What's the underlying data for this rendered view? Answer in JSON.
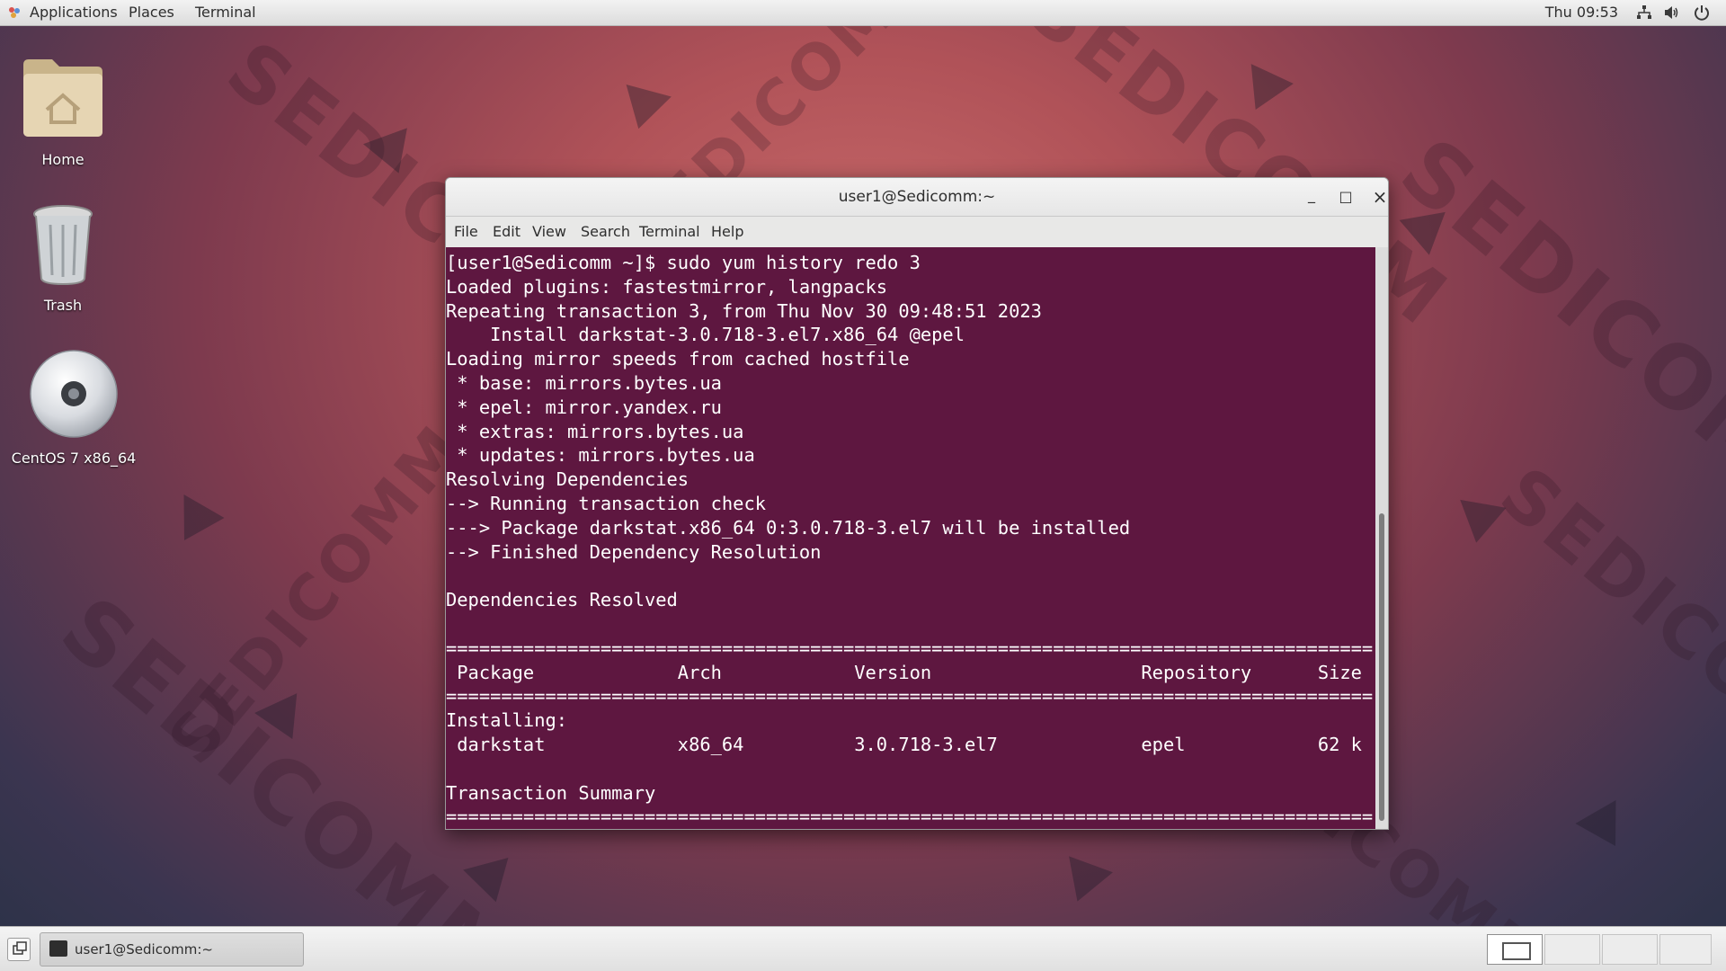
{
  "top_panel": {
    "menus": [
      "Applications",
      "Places",
      "Terminal"
    ],
    "clock": "Thu 09:53",
    "tray_icons": [
      "network-icon",
      "volume-icon",
      "power-icon"
    ]
  },
  "desktop": {
    "icons": [
      {
        "label": "Home",
        "icon": "home-folder-icon"
      },
      {
        "label": "Trash",
        "icon": "trash-icon"
      },
      {
        "label": "CentOS 7 x86_64",
        "icon": "disc-icon"
      }
    ],
    "wallpaper_text": "SEDICOMM",
    "colors": {
      "wallpaper_center": "#c86a6a",
      "wallpaper_edge": "#2a3247"
    }
  },
  "terminal_window": {
    "title": "user1@Sedicomm:~",
    "controls": {
      "minimize": "_",
      "maximize": "□",
      "close": "×"
    },
    "menu": [
      "File",
      "Edit",
      "View",
      "Search",
      "Terminal",
      "Help"
    ],
    "background_color": "#5e1740",
    "text_color": "#ffffff",
    "lines": [
      "[user1@Sedicomm ~]$ sudo yum history redo 3",
      "Loaded plugins: fastestmirror, langpacks",
      "Repeating transaction 3, from Thu Nov 30 09:48:51 2023",
      "    Install darkstat-3.0.718-3.el7.x86_64 @epel",
      "Loading mirror speeds from cached hostfile",
      " * base: mirrors.bytes.ua",
      " * epel: mirror.yandex.ru",
      " * extras: mirrors.bytes.ua",
      " * updates: mirrors.bytes.ua",
      "Resolving Dependencies",
      "--> Running transaction check",
      "---> Package darkstat.x86_64 0:3.0.718-3.el7 will be installed",
      "--> Finished Dependency Resolution",
      "",
      "Dependencies Resolved",
      "",
      "====================================================================================",
      " Package             Arch            Version                   Repository      Size",
      "====================================================================================",
      "Installing:",
      " darkstat            x86_64          3.0.718-3.el7             epel            62 k",
      "",
      "Transaction Summary",
      "===================================================================================="
    ]
  },
  "taskbar": {
    "task_label": "user1@Sedicomm:~",
    "workspaces": 4
  }
}
